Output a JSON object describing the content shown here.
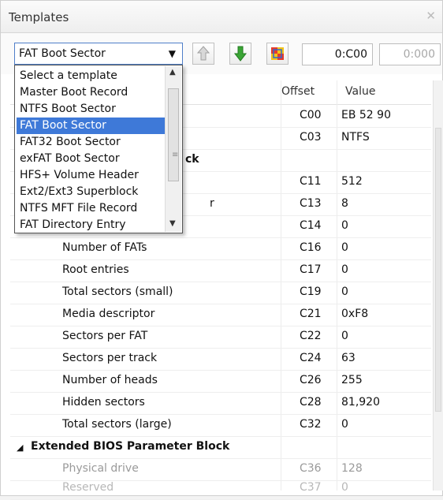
{
  "window": {
    "title": "Templates",
    "close_glyph": "✕"
  },
  "toolbar": {
    "template_selected": "FAT Boot Sector",
    "offset_value": "0:C00",
    "offset_value2": "0:000",
    "icons": [
      "arrow-up-icon",
      "arrow-down-icon",
      "windows-icon"
    ],
    "colors": {
      "down_arrow": "#3aa535",
      "up_arrow": "#a0a0a0"
    }
  },
  "dropdown": {
    "items": [
      "Select a template",
      "Master Boot Record",
      "NTFS Boot Sector",
      "FAT Boot Sector",
      "FAT32 Boot Sector",
      "exFAT Boot Sector",
      "HFS+ Volume Header",
      "Ext2/Ext3 Superblock",
      "NTFS MFT File Record",
      "FAT Directory Entry"
    ],
    "selected_index": 3
  },
  "table": {
    "columns": {
      "offset": "Offset",
      "value": "Value"
    },
    "visible_rows": [
      {
        "offset": "C00",
        "value": "EB 52 90"
      },
      {
        "offset": "C03",
        "value": "NTFS"
      }
    ],
    "group_partial": "ck",
    "partial_label": "r",
    "params": [
      {
        "offset": "C11",
        "value": "512"
      },
      {
        "offset": "C13",
        "value": "8"
      },
      {
        "offset": "C14",
        "value": "0"
      },
      {
        "name": "Number of FATs",
        "offset": "C16",
        "value": "0"
      },
      {
        "name": "Root entries",
        "offset": "C17",
        "value": "0"
      },
      {
        "name": "Total sectors (small)",
        "offset": "C19",
        "value": "0"
      },
      {
        "name": "Media descriptor",
        "offset": "C21",
        "value": "0xF8"
      },
      {
        "name": "Sectors per FAT",
        "offset": "C22",
        "value": "0"
      },
      {
        "name": "Sectors per track",
        "offset": "C24",
        "value": "63"
      },
      {
        "name": "Number of heads",
        "offset": "C26",
        "value": "255"
      },
      {
        "name": "Hidden sectors",
        "offset": "C28",
        "value": "81,920"
      },
      {
        "name": "Total sectors (large)",
        "offset": "C32",
        "value": "0"
      }
    ],
    "extended_group": "Extended BIOS Parameter Block",
    "extended_rows": [
      {
        "name": "Physical drive",
        "offset": "C36",
        "value": "128"
      },
      {
        "name": "Reserved",
        "offset": "C37",
        "value": "0"
      }
    ]
  }
}
